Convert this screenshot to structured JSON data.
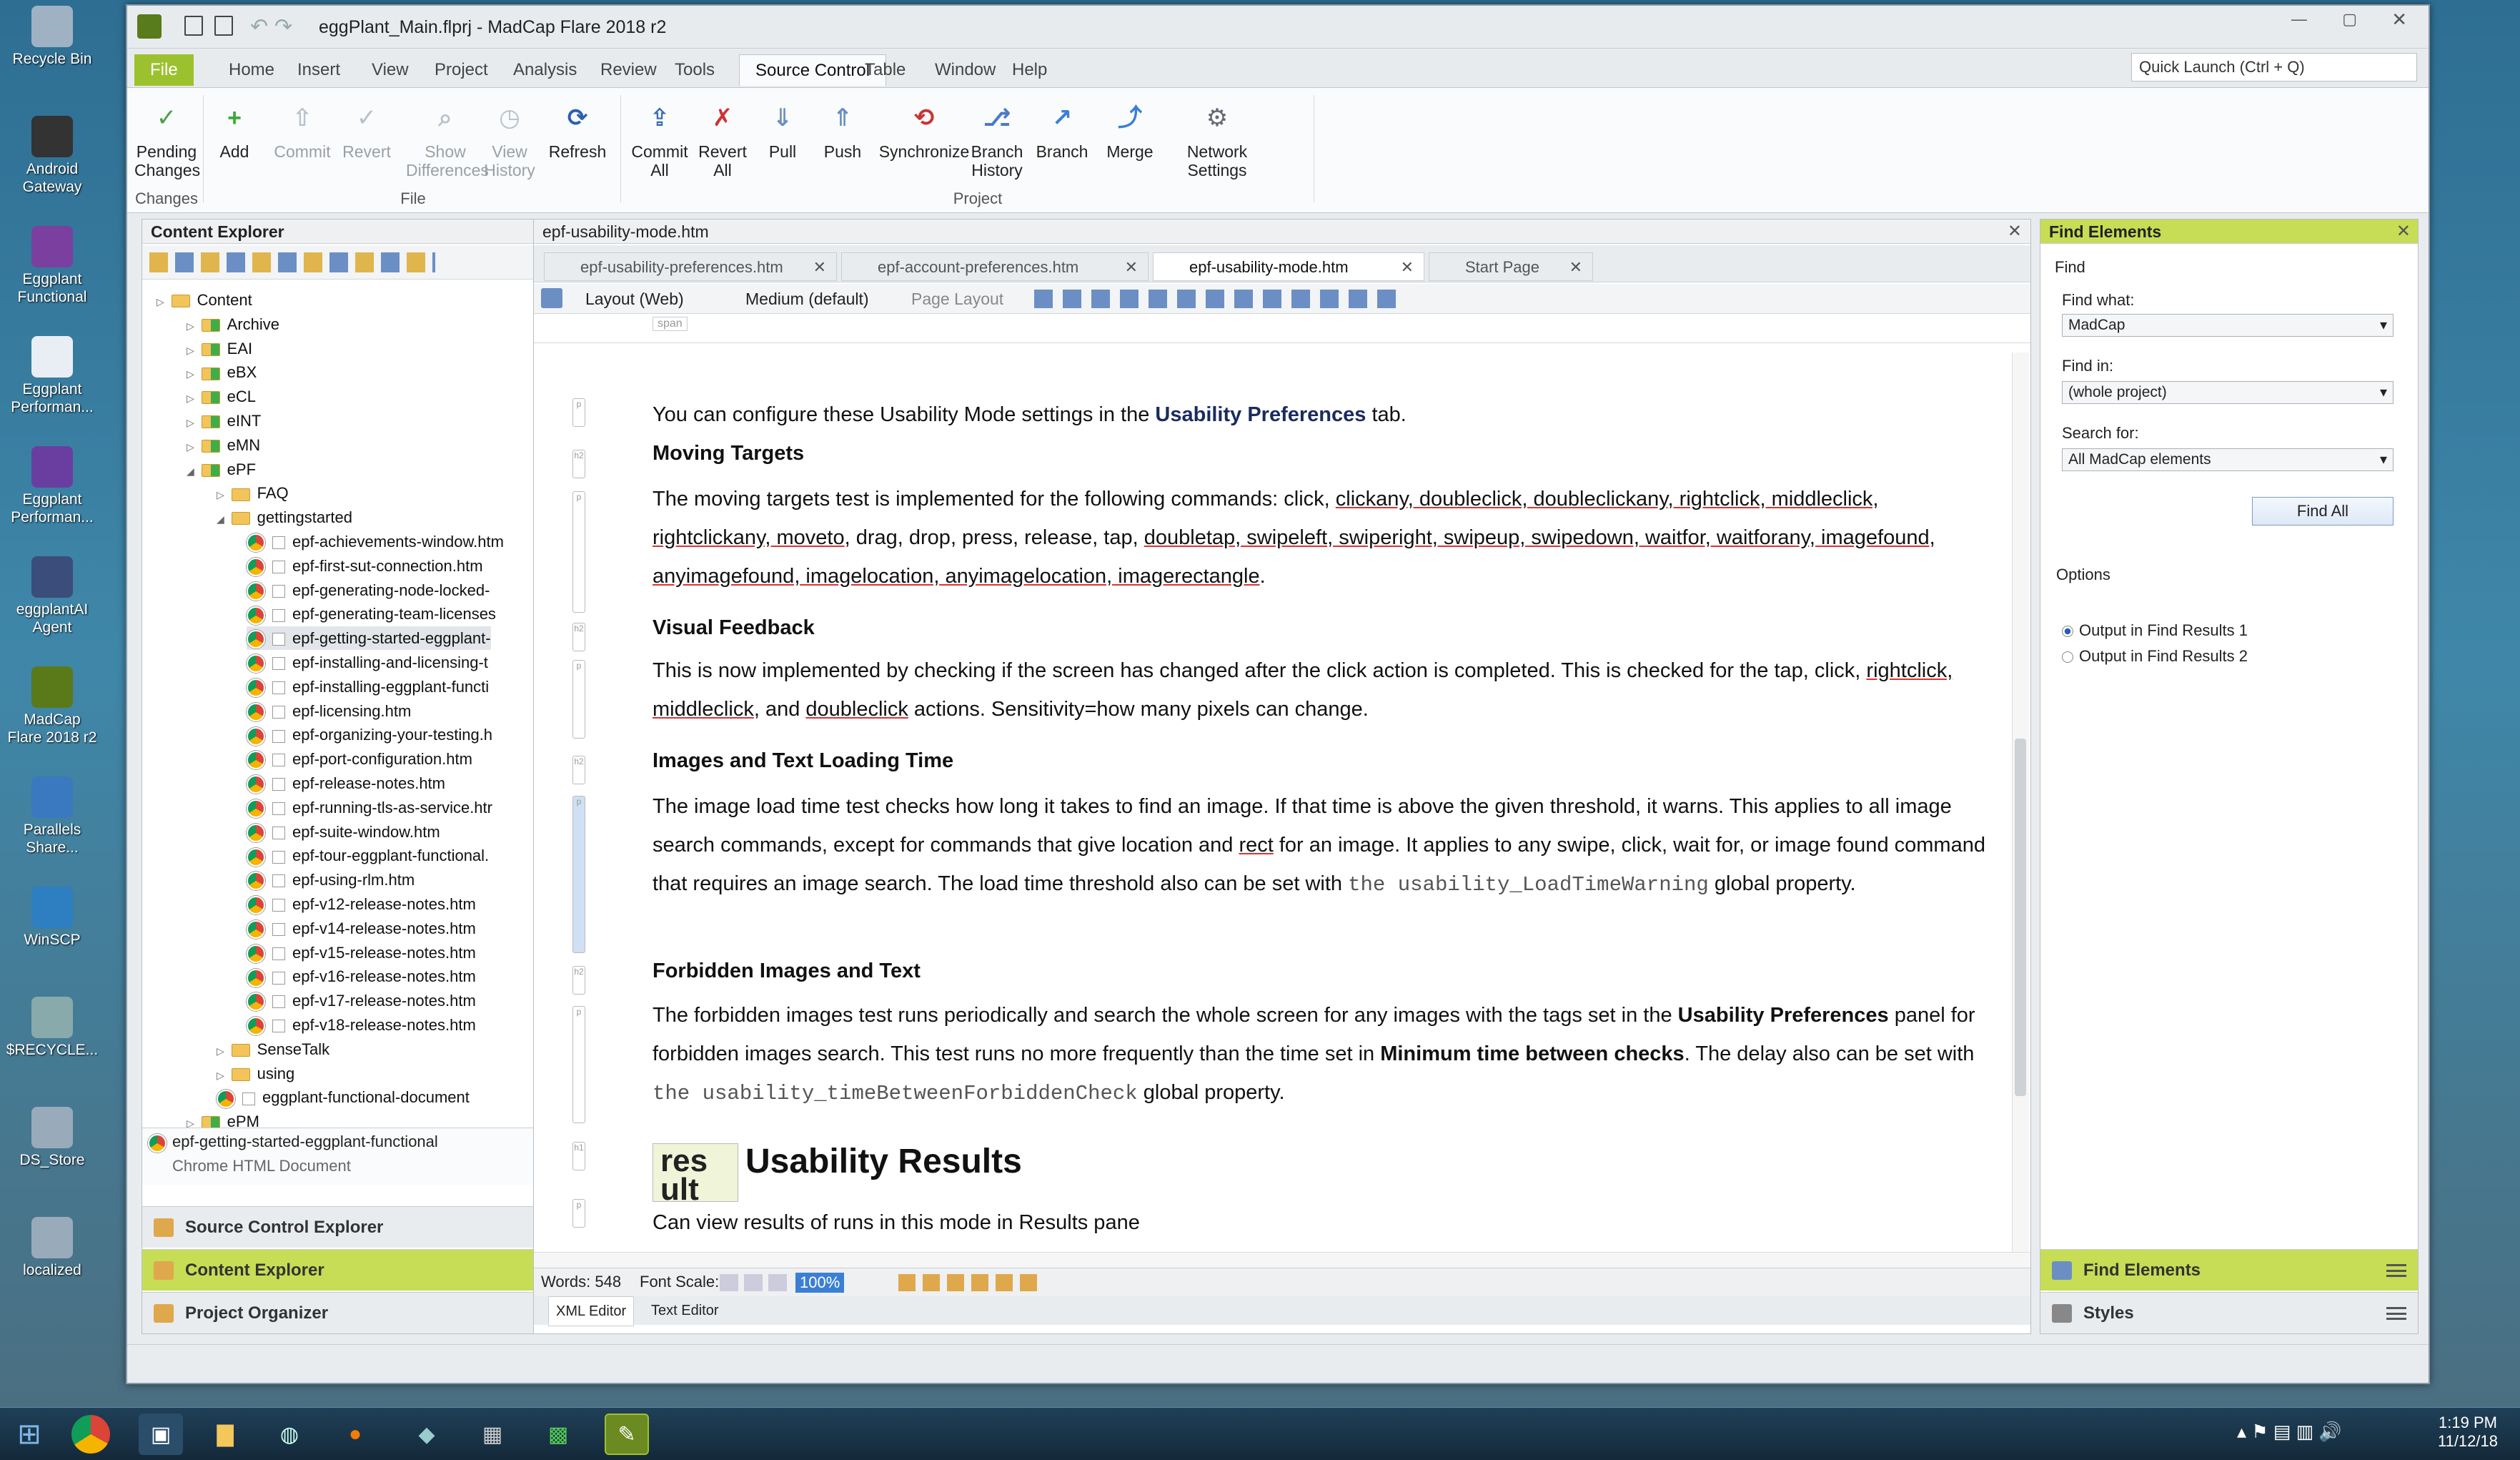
{
  "desktop": {
    "icons": [
      {
        "label": "Recycle Bin",
        "icon": "recycle-bin-icon",
        "color": "#9fb2c3"
      },
      {
        "label": "Android Gateway",
        "icon": "android-icon",
        "color": "#333"
      },
      {
        "label": "Eggplant Functional",
        "icon": "eggplant-icon",
        "color": "#7b3fa0"
      },
      {
        "label": "Eggplant Performan...",
        "icon": "chart-icon",
        "color": "#e8eef4"
      },
      {
        "label": "Eggplant Performan...",
        "icon": "eggplant-p-icon",
        "color": "#6a3ea0"
      },
      {
        "label": "eggplantAI Agent",
        "icon": "ai-icon",
        "color": "#3b4d7a"
      },
      {
        "label": "MadCap Flare 2018 r2",
        "icon": "madcap-icon",
        "color": "#5a7a1a"
      },
      {
        "label": "Parallels Share...",
        "icon": "computer-icon",
        "color": "#3a78c0"
      },
      {
        "label": "WinSCP",
        "icon": "winscp-icon",
        "color": "#2d7fc1"
      },
      {
        "label": "$RECYCLE...",
        "icon": "recycle-icon",
        "color": "#8aa"
      },
      {
        "label": "DS_Store",
        "icon": "file-icon",
        "color": "#9ab"
      },
      {
        "label": "localized",
        "icon": "file-icon",
        "color": "#9ab"
      }
    ]
  },
  "window": {
    "title": "eggPlant_Main.flprj - MadCap Flare 2018 r2",
    "quick_launch": "Quick Launch (Ctrl + Q)"
  },
  "ribbon": {
    "tabs": [
      "File",
      "Home",
      "Insert",
      "View",
      "Project",
      "Analysis",
      "Review",
      "Tools",
      "Source Control",
      "Table",
      "Window",
      "Help"
    ],
    "buttons": [
      {
        "label": "Pending Changes",
        "icon": "pending-changes-icon",
        "enabled": true
      },
      {
        "label": "Add",
        "icon": "add-icon",
        "enabled": true
      },
      {
        "label": "Commit",
        "icon": "commit-icon",
        "enabled": false
      },
      {
        "label": "Revert",
        "icon": "revert-icon",
        "enabled": false
      },
      {
        "label": "Show Differences",
        "icon": "show-differences-icon",
        "enabled": false
      },
      {
        "label": "View History",
        "icon": "view-history-icon",
        "enabled": false
      },
      {
        "label": "Refresh",
        "icon": "refresh-icon",
        "enabled": true
      },
      {
        "label": "Commit All",
        "icon": "commit-all-icon",
        "enabled": true
      },
      {
        "label": "Revert All",
        "icon": "revert-all-icon",
        "enabled": true
      },
      {
        "label": "Pull",
        "icon": "pull-icon",
        "enabled": true
      },
      {
        "label": "Push",
        "icon": "push-icon",
        "enabled": true
      },
      {
        "label": "Synchronize",
        "icon": "synchronize-icon",
        "enabled": true
      },
      {
        "label": "Branch History",
        "icon": "branch-history-icon",
        "enabled": true
      },
      {
        "label": "Branch",
        "icon": "branch-icon",
        "enabled": true
      },
      {
        "label": "Merge",
        "icon": "merge-icon",
        "enabled": true
      },
      {
        "label": "Network Settings",
        "icon": "network-settings-icon",
        "enabled": true
      }
    ],
    "groups": [
      "Changes",
      "File",
      "Project"
    ]
  },
  "content_explorer": {
    "title": "Content Explorer",
    "tree": [
      {
        "label": "Content",
        "type": "folder",
        "depth": 0
      },
      {
        "label": "Archive",
        "type": "folder",
        "depth": 1
      },
      {
        "label": "EAI",
        "type": "folder",
        "depth": 1
      },
      {
        "label": "eBX",
        "type": "folder",
        "depth": 1
      },
      {
        "label": "eCL",
        "type": "folder",
        "depth": 1
      },
      {
        "label": "eINT",
        "type": "folder",
        "depth": 1
      },
      {
        "label": "eMN",
        "type": "folder",
        "depth": 1
      },
      {
        "label": "ePF",
        "type": "folder",
        "depth": 1
      },
      {
        "label": "FAQ",
        "type": "folder",
        "depth": 2
      },
      {
        "label": "gettingstarted",
        "type": "folder",
        "depth": 2
      },
      {
        "label": "epf-achievements-window.htm",
        "type": "doc",
        "depth": 3
      },
      {
        "label": "epf-first-sut-connection.htm",
        "type": "doc",
        "depth": 3
      },
      {
        "label": "epf-generating-node-locked-",
        "type": "doc",
        "depth": 3
      },
      {
        "label": "epf-generating-team-licenses",
        "type": "doc",
        "depth": 3
      },
      {
        "label": "epf-getting-started-eggplant-",
        "type": "doc",
        "depth": 3
      },
      {
        "label": "epf-installing-and-licensing-t",
        "type": "doc",
        "depth": 3
      },
      {
        "label": "epf-installing-eggplant-functi",
        "type": "doc",
        "depth": 3
      },
      {
        "label": "epf-licensing.htm",
        "type": "doc",
        "depth": 3
      },
      {
        "label": "epf-organizing-your-testing.h",
        "type": "doc",
        "depth": 3
      },
      {
        "label": "epf-port-configuration.htm",
        "type": "doc",
        "depth": 3
      },
      {
        "label": "epf-release-notes.htm",
        "type": "doc",
        "depth": 3
      },
      {
        "label": "epf-running-tls-as-service.htr",
        "type": "doc",
        "depth": 3
      },
      {
        "label": "epf-suite-window.htm",
        "type": "doc",
        "depth": 3
      },
      {
        "label": "epf-tour-eggplant-functional.",
        "type": "doc",
        "depth": 3
      },
      {
        "label": "epf-using-rlm.htm",
        "type": "doc",
        "depth": 3
      },
      {
        "label": "epf-v12-release-notes.htm",
        "type": "doc",
        "depth": 3
      },
      {
        "label": "epf-v14-release-notes.htm",
        "type": "doc",
        "depth": 3
      },
      {
        "label": "epf-v15-release-notes.htm",
        "type": "doc",
        "depth": 3
      },
      {
        "label": "epf-v16-release-notes.htm",
        "type": "doc",
        "depth": 3
      },
      {
        "label": "epf-v17-release-notes.htm",
        "type": "doc",
        "depth": 3
      },
      {
        "label": "epf-v18-release-notes.htm",
        "type": "doc",
        "depth": 3
      },
      {
        "label": "SenseTalk",
        "type": "folder",
        "depth": 2
      },
      {
        "label": "using",
        "type": "folder",
        "depth": 2
      },
      {
        "label": "eggplant-functional-document",
        "type": "doc",
        "depth": 2
      },
      {
        "label": "ePM",
        "type": "folder",
        "depth": 1
      }
    ],
    "selected_file": "epf-getting-started-eggplant-functional",
    "selected_type": "Chrome HTML Document",
    "bottom_tabs": [
      "Source Control Explorer",
      "Content Explorer",
      "Project Organizer"
    ]
  },
  "editor": {
    "window_title": "epf-usability-mode.htm",
    "tabs": [
      "epf-usability-preferences.htm",
      "epf-account-preferences.htm",
      "epf-usability-mode.htm",
      "Start Page"
    ],
    "toolbar": {
      "layout": "Layout (Web)",
      "medium": "Medium (default)",
      "page_layout": "Page Layout"
    },
    "span_tag": "span",
    "doc": {
      "intro": "You can configure these Usability Mode settings in the ",
      "intro_link": "Usability Preferences",
      "intro_end": " tab.",
      "h_moving": "Moving Targets",
      "p_moving_1": "The moving targets test is implemented for the following commands: click, ",
      "moving_cmds": "clickany, doubleclick, doubleclickany, rightclick, middleclick, rightclickany, moveto",
      "p_moving_2": ", drag, drop, press, release, tap, ",
      "moving_cmds2": "doubletap, swipeleft, swiperight, swipeup, swipedown, waitfor, waitforany, imagefound, anyimagefound, imagelocation, anyimagelocation, imagerectangle",
      "p_moving_3": ".",
      "h_visual": "Visual Feedback",
      "p_visual": "This is now implemented by checking if the screen has changed after the click action is completed. This is checked for the tap, click, ",
      "visual_cmds": "rightclick, middleclick",
      "p_visual_2": ", and ",
      "visual_cmd3": "doubleclick",
      "p_visual_3": " actions. Sensitivity=how many pixels can change.",
      "h_images": "Images and Text Loading Time",
      "p_images_1": "The image load time test checks how long it takes to find an image. If that time is above the given threshold, it warns. This applies to all image search commands, except for commands that give location and ",
      "images_rect": "rect",
      "p_images_2": " for an image. It applies to any swipe, click, wait for, or image found command that requires an image search. The load time threshold also can be set with ",
      "images_code": "the usability_LoadTimeWarning",
      "p_images_3": " global property.",
      "h_forbidden": "Forbidden Images and Text",
      "p_forb_1": "The forbidden images test runs periodically and search the whole screen for any images with the tags set in the ",
      "forb_bold1": "Usability Preferences",
      "p_forb_2": " panel for forbidden images search. This test runs no more frequently than the time set in ",
      "forb_bold2": "Minimum time between checks",
      "p_forb_3": ". The delay also can be set with ",
      "forb_code": "the usability_timeBetweenForbiddenCheck",
      "p_forb_4": " global property.",
      "results_img": "res ult",
      "h_results": "Usability Results",
      "p_results": "Can view results of runs in this mode in Results pane"
    },
    "status": {
      "words": "Words: 548",
      "font_scale": "Font Scale:",
      "zoom": "100%"
    },
    "bottom_tabs": [
      "XML Editor",
      "Text Editor"
    ]
  },
  "find_elements": {
    "title": "Find Elements",
    "find_label": "Find",
    "find_what_label": "Find what:",
    "find_what_value": "MadCap",
    "find_in_label": "Find in:",
    "find_in_value": "(whole project)",
    "search_for_label": "Search for:",
    "search_for_value": "All MadCap elements",
    "find_all": "Find All",
    "options_label": "Options",
    "output1": "Output in Find Results 1",
    "output2": "Output in Find Results 2",
    "bottom_tabs": [
      "Find Elements",
      "Styles"
    ]
  },
  "taskbar": {
    "time": "1:19 PM",
    "date": "11/12/18"
  }
}
